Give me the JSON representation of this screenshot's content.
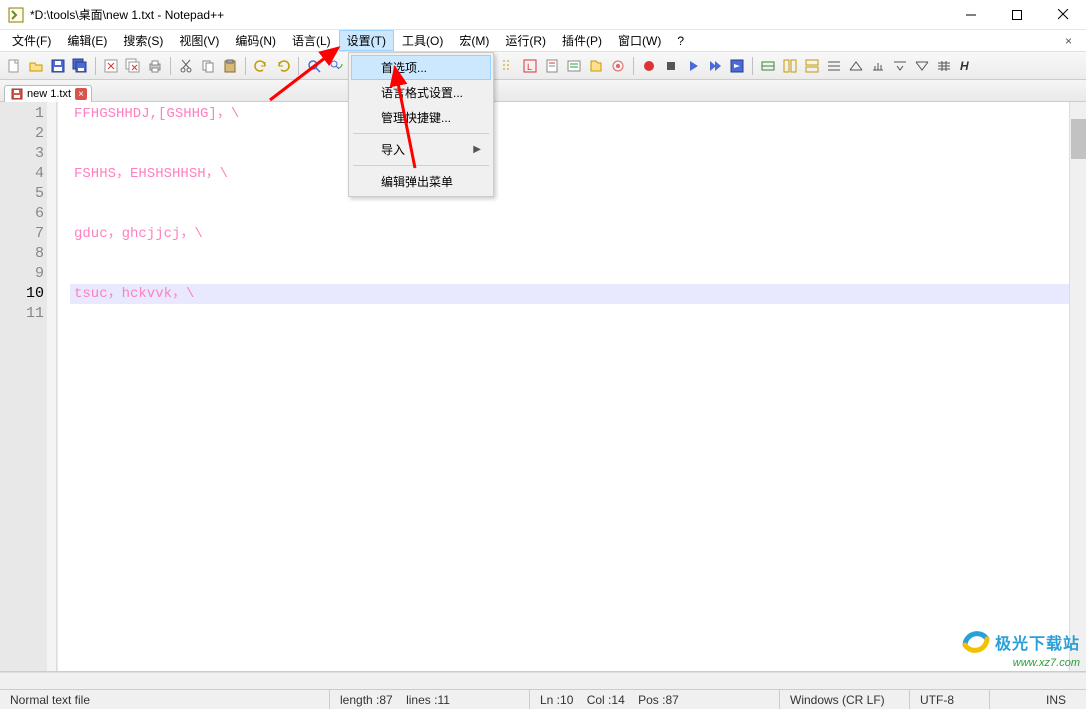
{
  "window": {
    "title": "*D:\\tools\\桌面\\new 1.txt - Notepad++"
  },
  "menu": {
    "items": [
      "文件(F)",
      "编辑(E)",
      "搜索(S)",
      "视图(V)",
      "编码(N)",
      "语言(L)",
      "设置(T)",
      "工具(O)",
      "宏(M)",
      "运行(R)",
      "插件(P)",
      "窗口(W)",
      "?"
    ],
    "active_index": 6
  },
  "dropdown": {
    "items": [
      {
        "label": "首选项...",
        "hover": true
      },
      {
        "label": "语言格式设置..."
      },
      {
        "label": "管理快捷键..."
      },
      {
        "sep": true
      },
      {
        "label": "导入",
        "submenu": true
      },
      {
        "sep": true
      },
      {
        "label": "编辑弹出菜单"
      }
    ]
  },
  "tab": {
    "name": "new 1.txt"
  },
  "editor": {
    "lines": [
      "FFHGSHHDJ,[GSHHG]，\\",
      "",
      "",
      "FSHHS，EHSHSHHSH，\\",
      "",
      "",
      "gduc，ghcjjcj，\\",
      "",
      "",
      "tsuc，hckvvk，\\",
      ""
    ],
    "current_line": 10
  },
  "status": {
    "filetype": "Normal text file",
    "length_label": "length : ",
    "length": "87",
    "lines_label": "lines : ",
    "lines": "11",
    "ln_label": "Ln : ",
    "ln": "10",
    "col_label": "Col : ",
    "col": "14",
    "pos_label": "Pos : ",
    "pos": "87",
    "eol": "Windows (CR LF)",
    "encoding": "UTF-8",
    "ovr": "INS"
  },
  "watermark": {
    "name": "极光下载站",
    "url": "www.xz7.com"
  }
}
